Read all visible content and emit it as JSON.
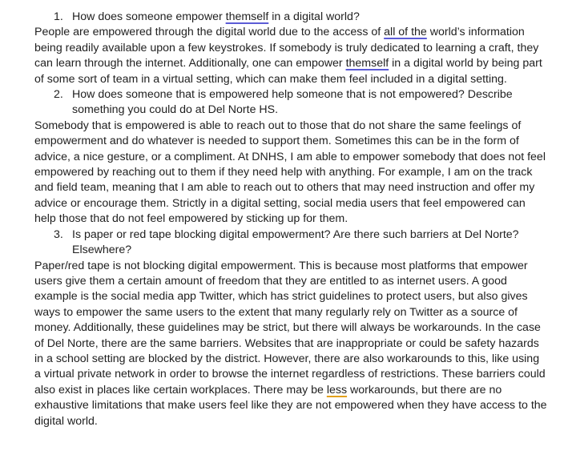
{
  "document": {
    "q1": {
      "number": "1.",
      "text_before": "How does someone empower ",
      "marked": "themself",
      "text_after": " in a digital world?"
    },
    "a1": {
      "part1": "People are empowered through the digital world due to the access of ",
      "marked1": "all of the",
      "part2": " world’s information being readily available upon a few keystrokes. If somebody is truly dedicated to learning a craft, they can learn through the internet. Additionally, one can empower ",
      "marked2": "themself",
      "part3": " in a digital world by being part of some sort of team in a virtual setting, which can make them feel included in a digital setting."
    },
    "q2": {
      "number": "2.",
      "text": "How does someone that is empowered help someone that is not empowered? Describe something you could do at Del Norte HS."
    },
    "a2": {
      "text": "Somebody that is empowered is able to reach out to those that do not share the same feelings of empowerment and do whatever is needed to support them. Sometimes this can be in the form of advice, a nice gesture, or a compliment. At DNHS, I am able to empower somebody that does not feel empowered by reaching out to them if they need help with anything. For example, I am on the track and field team, meaning that I am able to reach out to others that may need instruction and offer my advice or encourage them. Strictly in a digital setting, social media users that feel empowered can help those that do not feel empowered by sticking up for them."
    },
    "q3": {
      "number": "3.",
      "text": "Is paper or red tape blocking digital empowerment? Are there such barriers at Del Norte? Elsewhere?"
    },
    "a3": {
      "part1": "Paper/red tape is not blocking digital empowerment. This is because most platforms that empower users give them a certain amount of freedom that they are entitled to as internet users. A good example is the social media app Twitter, which has strict guidelines to protect users, but also gives ways to empower the same users to the extent that many regularly rely on Twitter as a source of money. Additionally, these guidelines may be strict, but there will always be workarounds. In the case of Del Norte, there are the same barriers. Websites that are inappropriate or could be safety hazards in a school setting are blocked by the district. However, there are also workarounds to this, like using a virtual private network in order to browse the internet regardless of restrictions. These barriers could also exist in places like certain workplaces. There may be ",
      "marked": "less",
      "part2": " workarounds, but there are no exhaustive limitations that make users feel like they are not empowered when they have access to the digital world."
    },
    "colors": {
      "text": "#1f1f1f",
      "spelling_underline": "#5b5bd6",
      "grammar_underline": "#e3a11b"
    }
  }
}
